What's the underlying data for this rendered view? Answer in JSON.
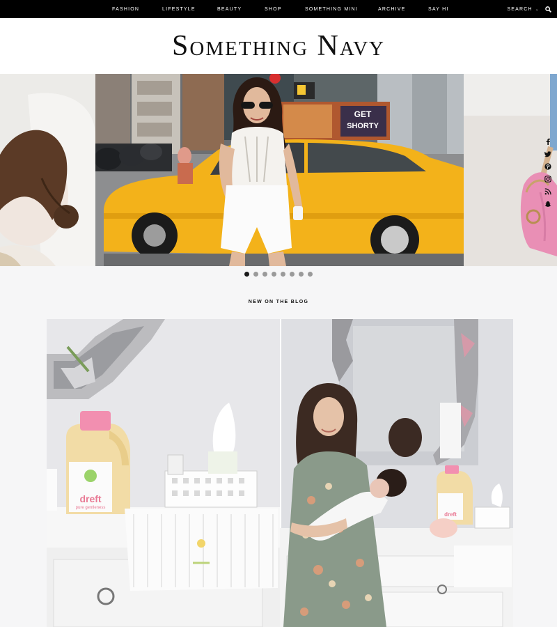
{
  "nav": {
    "items": [
      "FASHION",
      "LIFESTYLE",
      "BEAUTY",
      "SHOP",
      "SOMETHING MINI",
      "ARCHIVE",
      "SAY HI"
    ],
    "search_label": "SEARCH",
    "search_caret": "⌄"
  },
  "header": {
    "logo": "Something Navy"
  },
  "carousel": {
    "slide_count": 8,
    "active_index": 0,
    "billboard_text_1": "GET",
    "billboard_text_2": "SHORTY"
  },
  "social": {
    "icons": [
      "facebook-icon",
      "twitter-icon",
      "pinterest-icon",
      "instagram-icon",
      "rss-icon",
      "snapchat-icon"
    ]
  },
  "blog": {
    "section_title": "NEW ON THE BLOG",
    "product_label_1": "dreft",
    "product_label_2": "dreft",
    "product_sub": "pure gentleness"
  },
  "colors": {
    "nav_bg": "#000000",
    "taxi": "#f3b21a",
    "detergent_cap": "#f28fb0",
    "dot_active": "#1a1a1a"
  }
}
